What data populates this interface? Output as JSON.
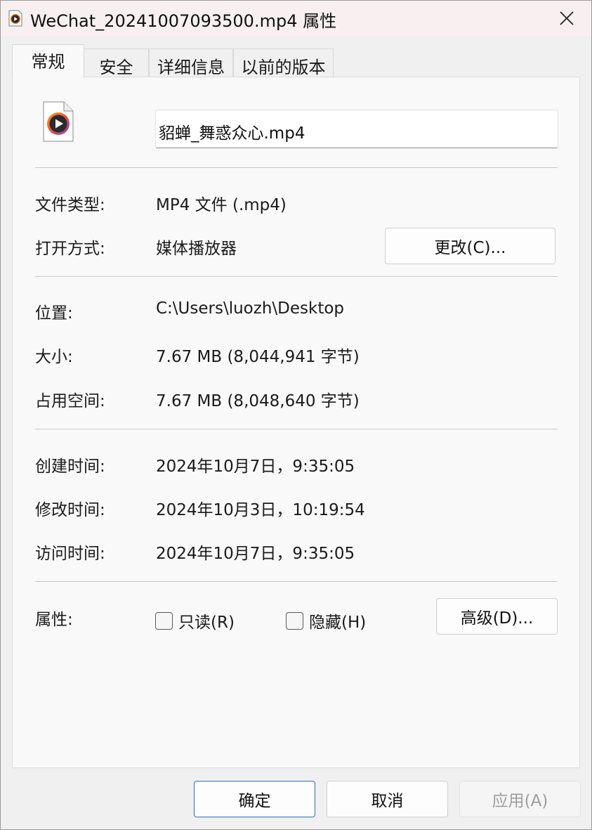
{
  "window": {
    "title": "WeChat_20241007093500.mp4 属性",
    "icon": "media-player-icon",
    "close_icon": "close-icon"
  },
  "tabs": [
    {
      "label": "常规",
      "active": true
    },
    {
      "label": "安全",
      "active": false
    },
    {
      "label": "详细信息",
      "active": false
    },
    {
      "label": "以前的版本",
      "active": false
    }
  ],
  "general": {
    "file_name": "貂蝉_舞惑众心.mp4",
    "file_type_label": "文件类型:",
    "file_type_value": "MP4 文件 (.mp4)",
    "open_with_label": "打开方式:",
    "open_with_value": "媒体播放器",
    "change_button": "更改(C)...",
    "location_label": "位置:",
    "location_value": "C:\\Users\\luozh\\Desktop",
    "size_label": "大小:",
    "size_value": "7.67 MB (8,044,941 字节)",
    "size_on_disk_label": "占用空间:",
    "size_on_disk_value": "7.67 MB (8,048,640 字节)",
    "created_label": "创建时间:",
    "created_value": "2024年10月7日，9:35:05",
    "modified_label": "修改时间:",
    "modified_value": "2024年10月3日，10:19:54",
    "accessed_label": "访问时间:",
    "accessed_value": "2024年10月7日，9:35:05",
    "attributes_label": "属性:",
    "readonly_label": "只读(R)",
    "readonly_checked": false,
    "hidden_label": "隐藏(H)",
    "hidden_checked": false,
    "advanced_button": "高级(D)..."
  },
  "footer": {
    "ok": "确定",
    "cancel": "取消",
    "apply": "应用(A)"
  },
  "colors": {
    "titlebar": "#f8f0f0",
    "panel": "#f9f9f9",
    "primary_border": "#2c6fbe",
    "icon_accent": "#f07a1e"
  }
}
